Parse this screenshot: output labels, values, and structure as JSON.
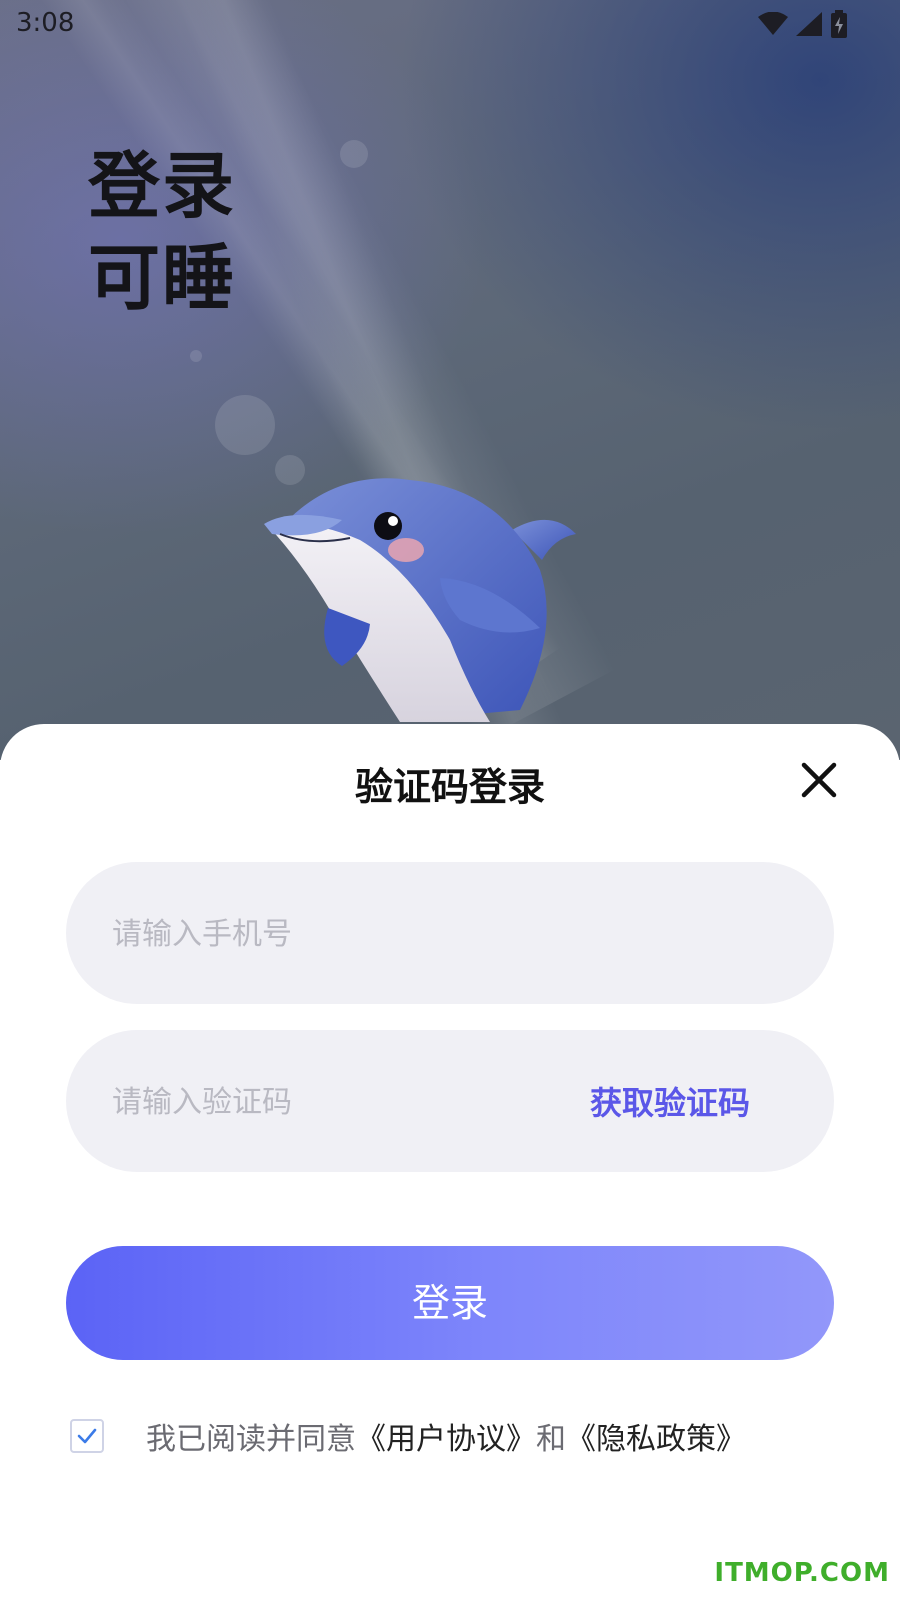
{
  "status_bar": {
    "time": "3:08"
  },
  "hero": {
    "title_line1": "登录",
    "title_line2": "可睡"
  },
  "sheet": {
    "title": "验证码登录",
    "phone_field": {
      "placeholder": "请输入手机号",
      "value": ""
    },
    "code_field": {
      "placeholder": "请输入验证码",
      "value": "",
      "get_code_label": "获取验证码"
    },
    "login_button": "登录",
    "agreement": {
      "prefix": "我已阅读并同意",
      "user_agreement": "《用户协议》",
      "connector": "和",
      "privacy_policy": "《隐私政策》",
      "checked": true
    }
  },
  "watermark": "ITMOP.COM",
  "colors": {
    "accent": "#5b57e8",
    "button_gradient_start": "#5b63f6",
    "button_gradient_end": "#9297fa",
    "field_bg": "#f0f0f5",
    "watermark": "#3fae2b"
  },
  "icons": [
    "wifi-icon",
    "cellular-signal-icon",
    "battery-charging-icon",
    "close-icon",
    "checkmark-icon"
  ]
}
